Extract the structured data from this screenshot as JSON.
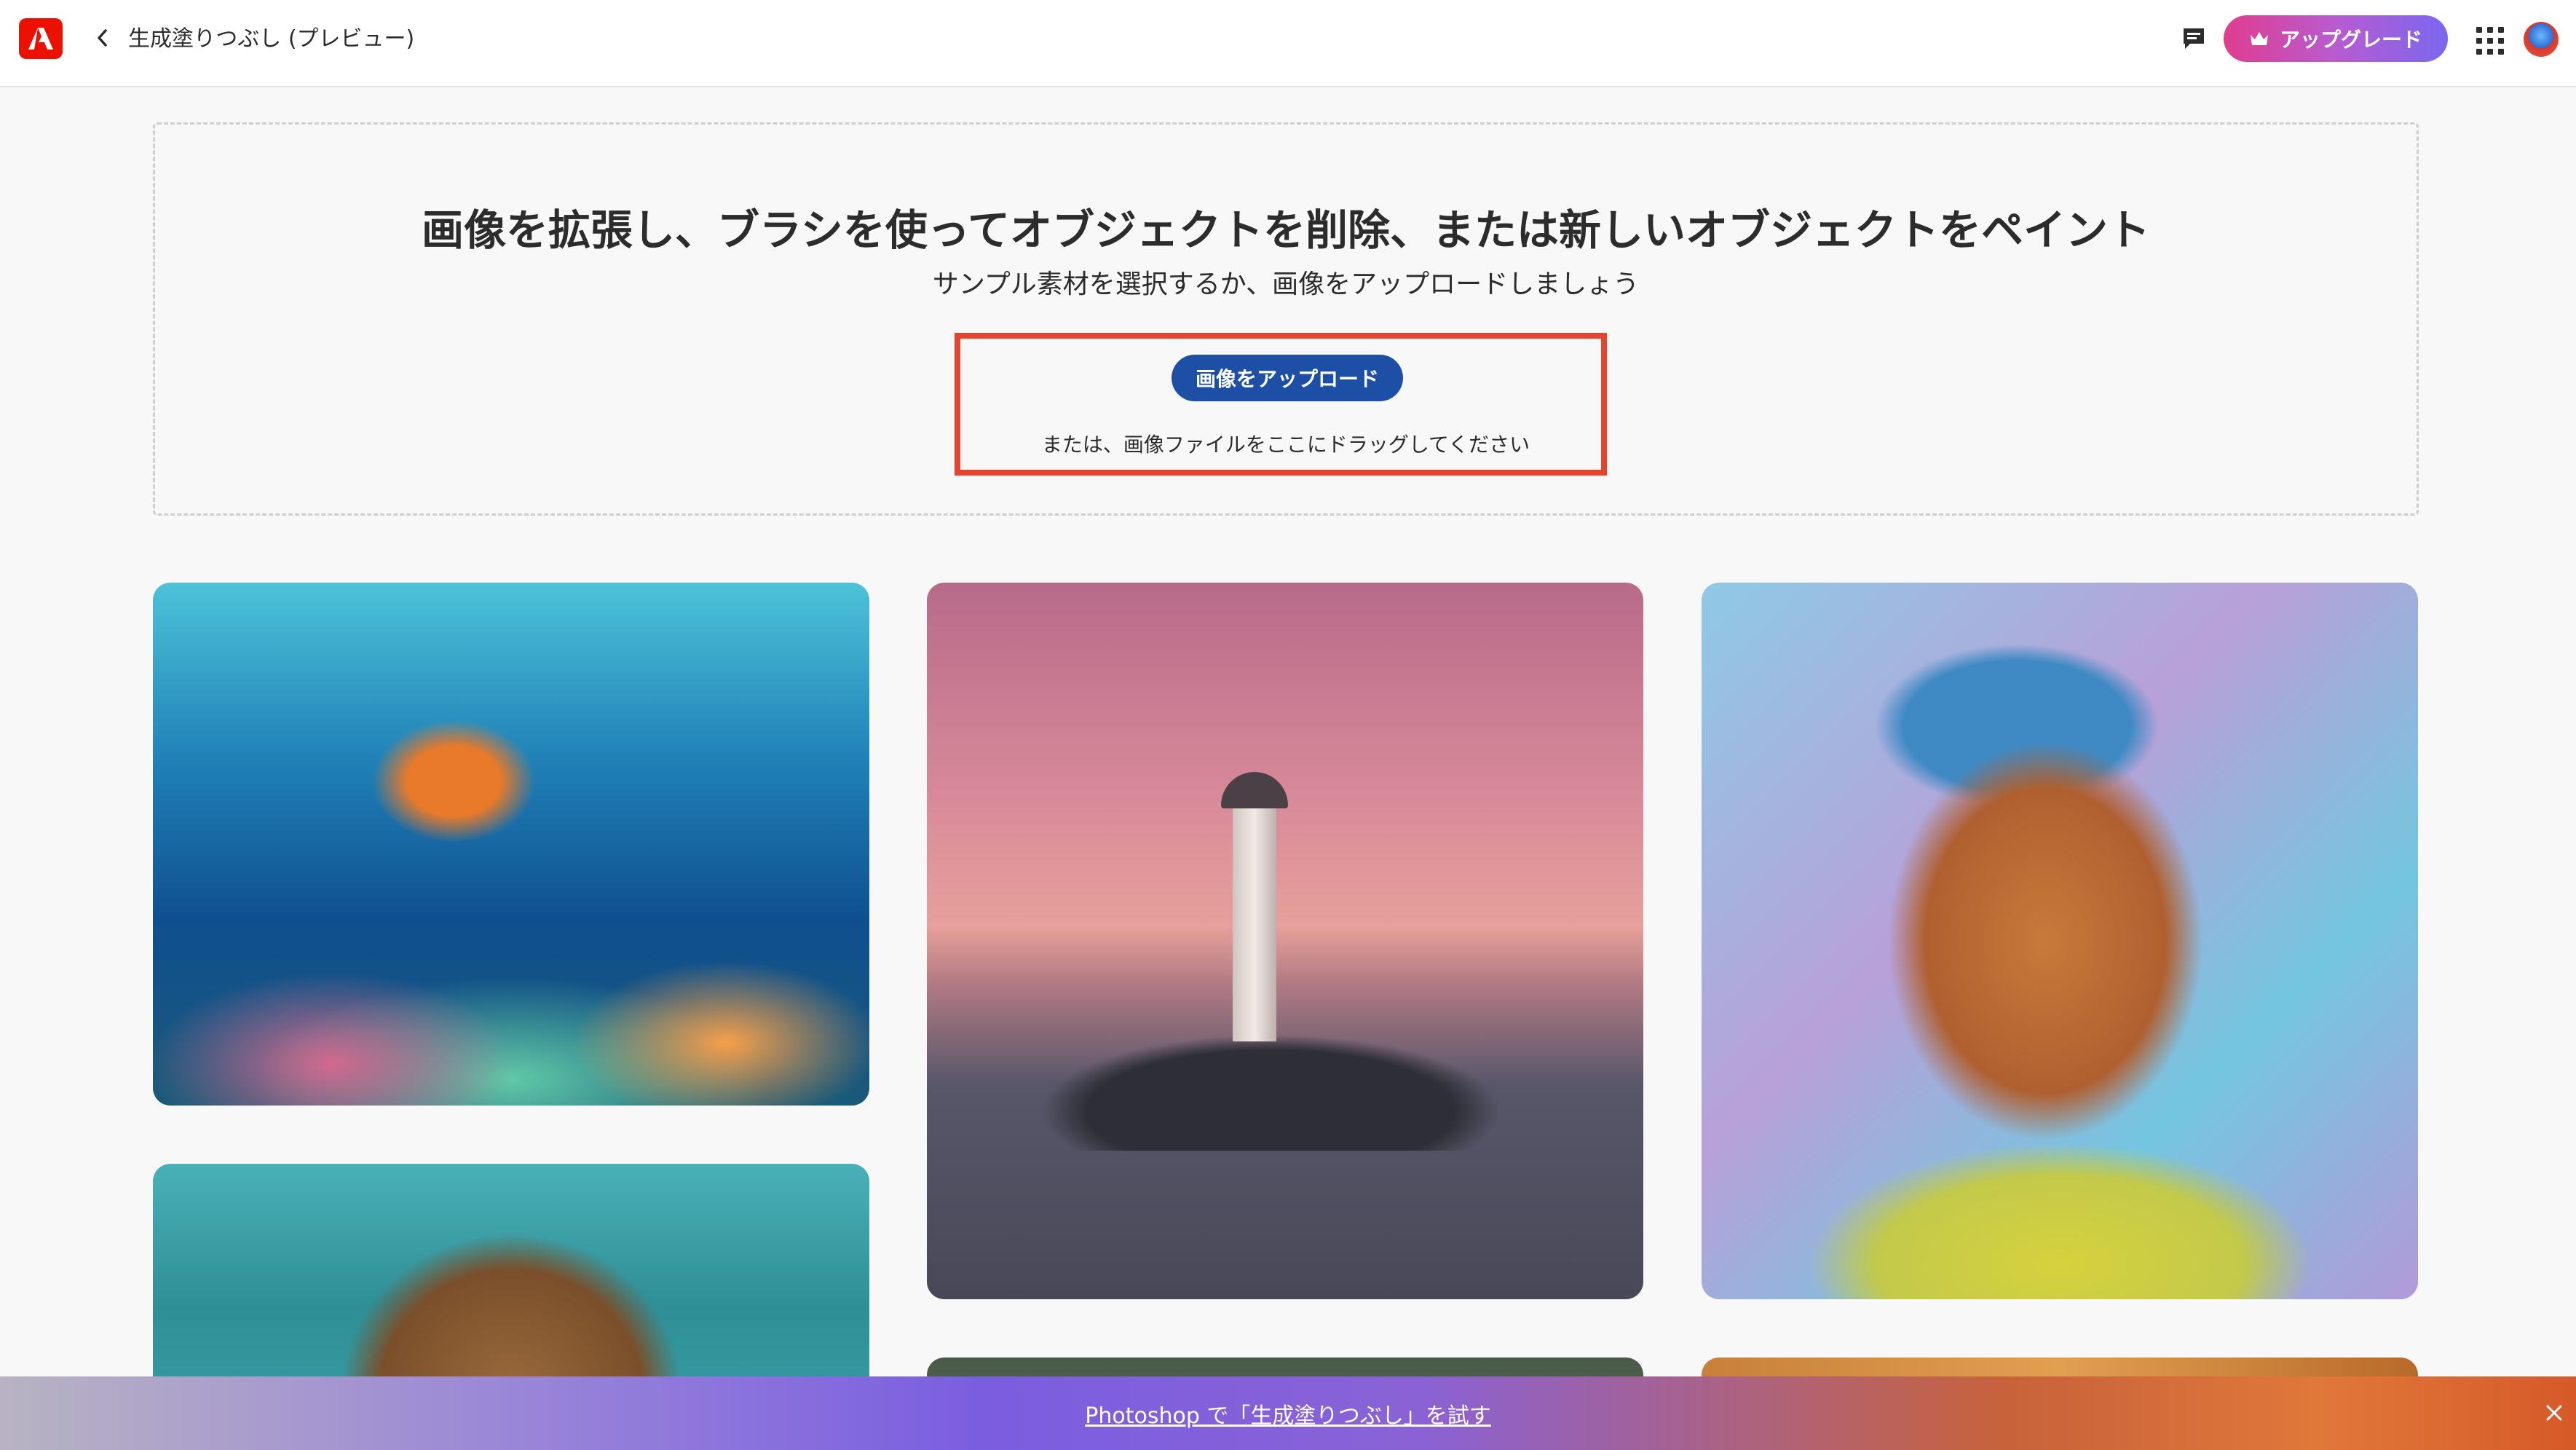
{
  "topbar": {
    "app_title": "生成塗りつぶし (プレビュー)",
    "upgrade_label": "アップグレード",
    "logo_icon": "adobe-logo-icon",
    "back_icon": "chevron-left-icon",
    "feedback_icon": "feedback-icon",
    "apps_icon": "apps-grid-icon",
    "brand_color": "#eb1000"
  },
  "dropzone": {
    "headline": "画像を拡張し、ブラシを使ってオブジェクトを削除、または新しいオブジェクトをペイント",
    "subline": "サンプル素材を選択するか、画像をアップロードしましょう",
    "upload_label": "画像をアップロード",
    "drag_hint": "または、画像ファイルをここにドラッグしてください",
    "upload_color": "#1d4fa6",
    "highlight_color": "#e5432d"
  },
  "samples": [
    {
      "name": "coral reef fish"
    },
    {
      "name": "lighthouse at sunset"
    },
    {
      "name": "portrait with blue beanie"
    },
    {
      "name": "bear underwater"
    },
    {
      "name": "sample 5"
    },
    {
      "name": "sample 6"
    }
  ],
  "promo": {
    "link_text": "Photoshop で「生成塗りつぶし」を試す",
    "close_icon": "close-icon"
  }
}
